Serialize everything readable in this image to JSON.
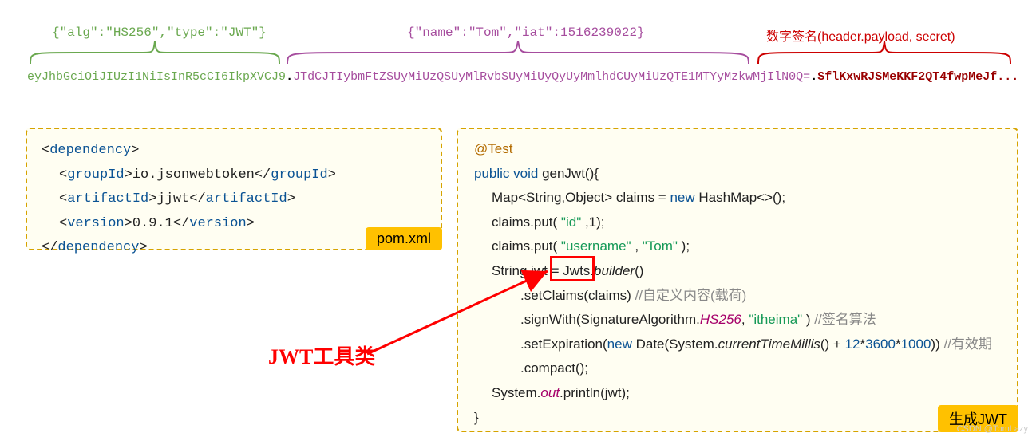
{
  "labels": {
    "header": "{\"alg\":\"HS256\",\"type\":\"JWT\"}",
    "payload": "{\"name\":\"Tom\",\"iat\":1516239022}",
    "signature": "数字签名(header.payload, secret)"
  },
  "jwt": {
    "header_b64": "eyJhbGciOiJIUzI1NiIsInR5cCI6IkpXVCJ9",
    "dot1": ".",
    "payload_b64": "JTdCJTIybmFtZSUyMiUzQSUyMlRvbSUyMiUyQyUyMmlhdCUyMiUzQTE1MTYyMzkwMjIlN0Q=",
    "dot2": ".",
    "sig_b64": "SflKxwRJSMeKKF2QT4fwpMeJf..."
  },
  "pom": {
    "dep_open_l": "<",
    "dep_open": "dependency",
    "dep_open_r": ">",
    "group_open_l": "<",
    "group_open": "groupId",
    "group_open_r": ">",
    "group_val": "io.jsonwebtoken",
    "group_close_l": "</",
    "group_close": "groupId",
    "group_close_r": ">",
    "art_open_l": "<",
    "art_open": "artifactId",
    "art_open_r": ">",
    "art_val": "jjwt",
    "art_close_l": "</",
    "art_close": "artifactId",
    "art_close_r": ">",
    "ver_open_l": "<",
    "ver_open": "version",
    "ver_open_r": ">",
    "ver_val": "0.9.1",
    "ver_close_l": "</",
    "ver_close": "version",
    "ver_close_r": ">",
    "dep_close_l": "</",
    "dep_close": "dependency",
    "dep_close_r": ">",
    "tag": "pom.xml"
  },
  "java": {
    "at": "@Test",
    "pub": "public ",
    "vd": "void ",
    "fn": "genJwt(){",
    "l3a": "Map<String,Object> claims = ",
    "l3b": "new ",
    "l3c": "HashMap<>();",
    "l4a": "claims.put( ",
    "l4b": "\"id\"",
    "l4c": " ,1);",
    "l5a": "claims.put( ",
    "l5b": "\"username\"",
    "l5c": " , ",
    "l5d": "\"Tom\"",
    "l5e": " );",
    "l6a": "String jwt = ",
    "l6b": "Jwts.",
    "l6c": "builder",
    "l6d": "()",
    "l7a": ".setClaims(claims) ",
    "l7b": "//自定义内容(载荷)",
    "l8a": ".signWith(SignatureAlgorithm.",
    "l8b": "HS256",
    "l8c": ",  ",
    "l8d": "\"itheima\"",
    "l8e": " ) ",
    "l8f": "//签名算法",
    "l9a": ".setExpiration(",
    "l9b": "new ",
    "l9c": "Date(System.",
    "l9d": "currentTimeMillis",
    "l9e": "() + ",
    "l9f": "12",
    "l9g": "*",
    "l9h": "3600",
    "l9i": "*",
    "l9j": "1000",
    "l9k": ")) ",
    "l9l": "//有效期",
    "l10": ".compact();",
    "l11a": "System.",
    "l11b": "out",
    "l11c": ".println(jwt);",
    "l12": "}",
    "tag": "生成JWT"
  },
  "tool_label": "JWT工具类",
  "watermark": "CSDN @TomLazy"
}
